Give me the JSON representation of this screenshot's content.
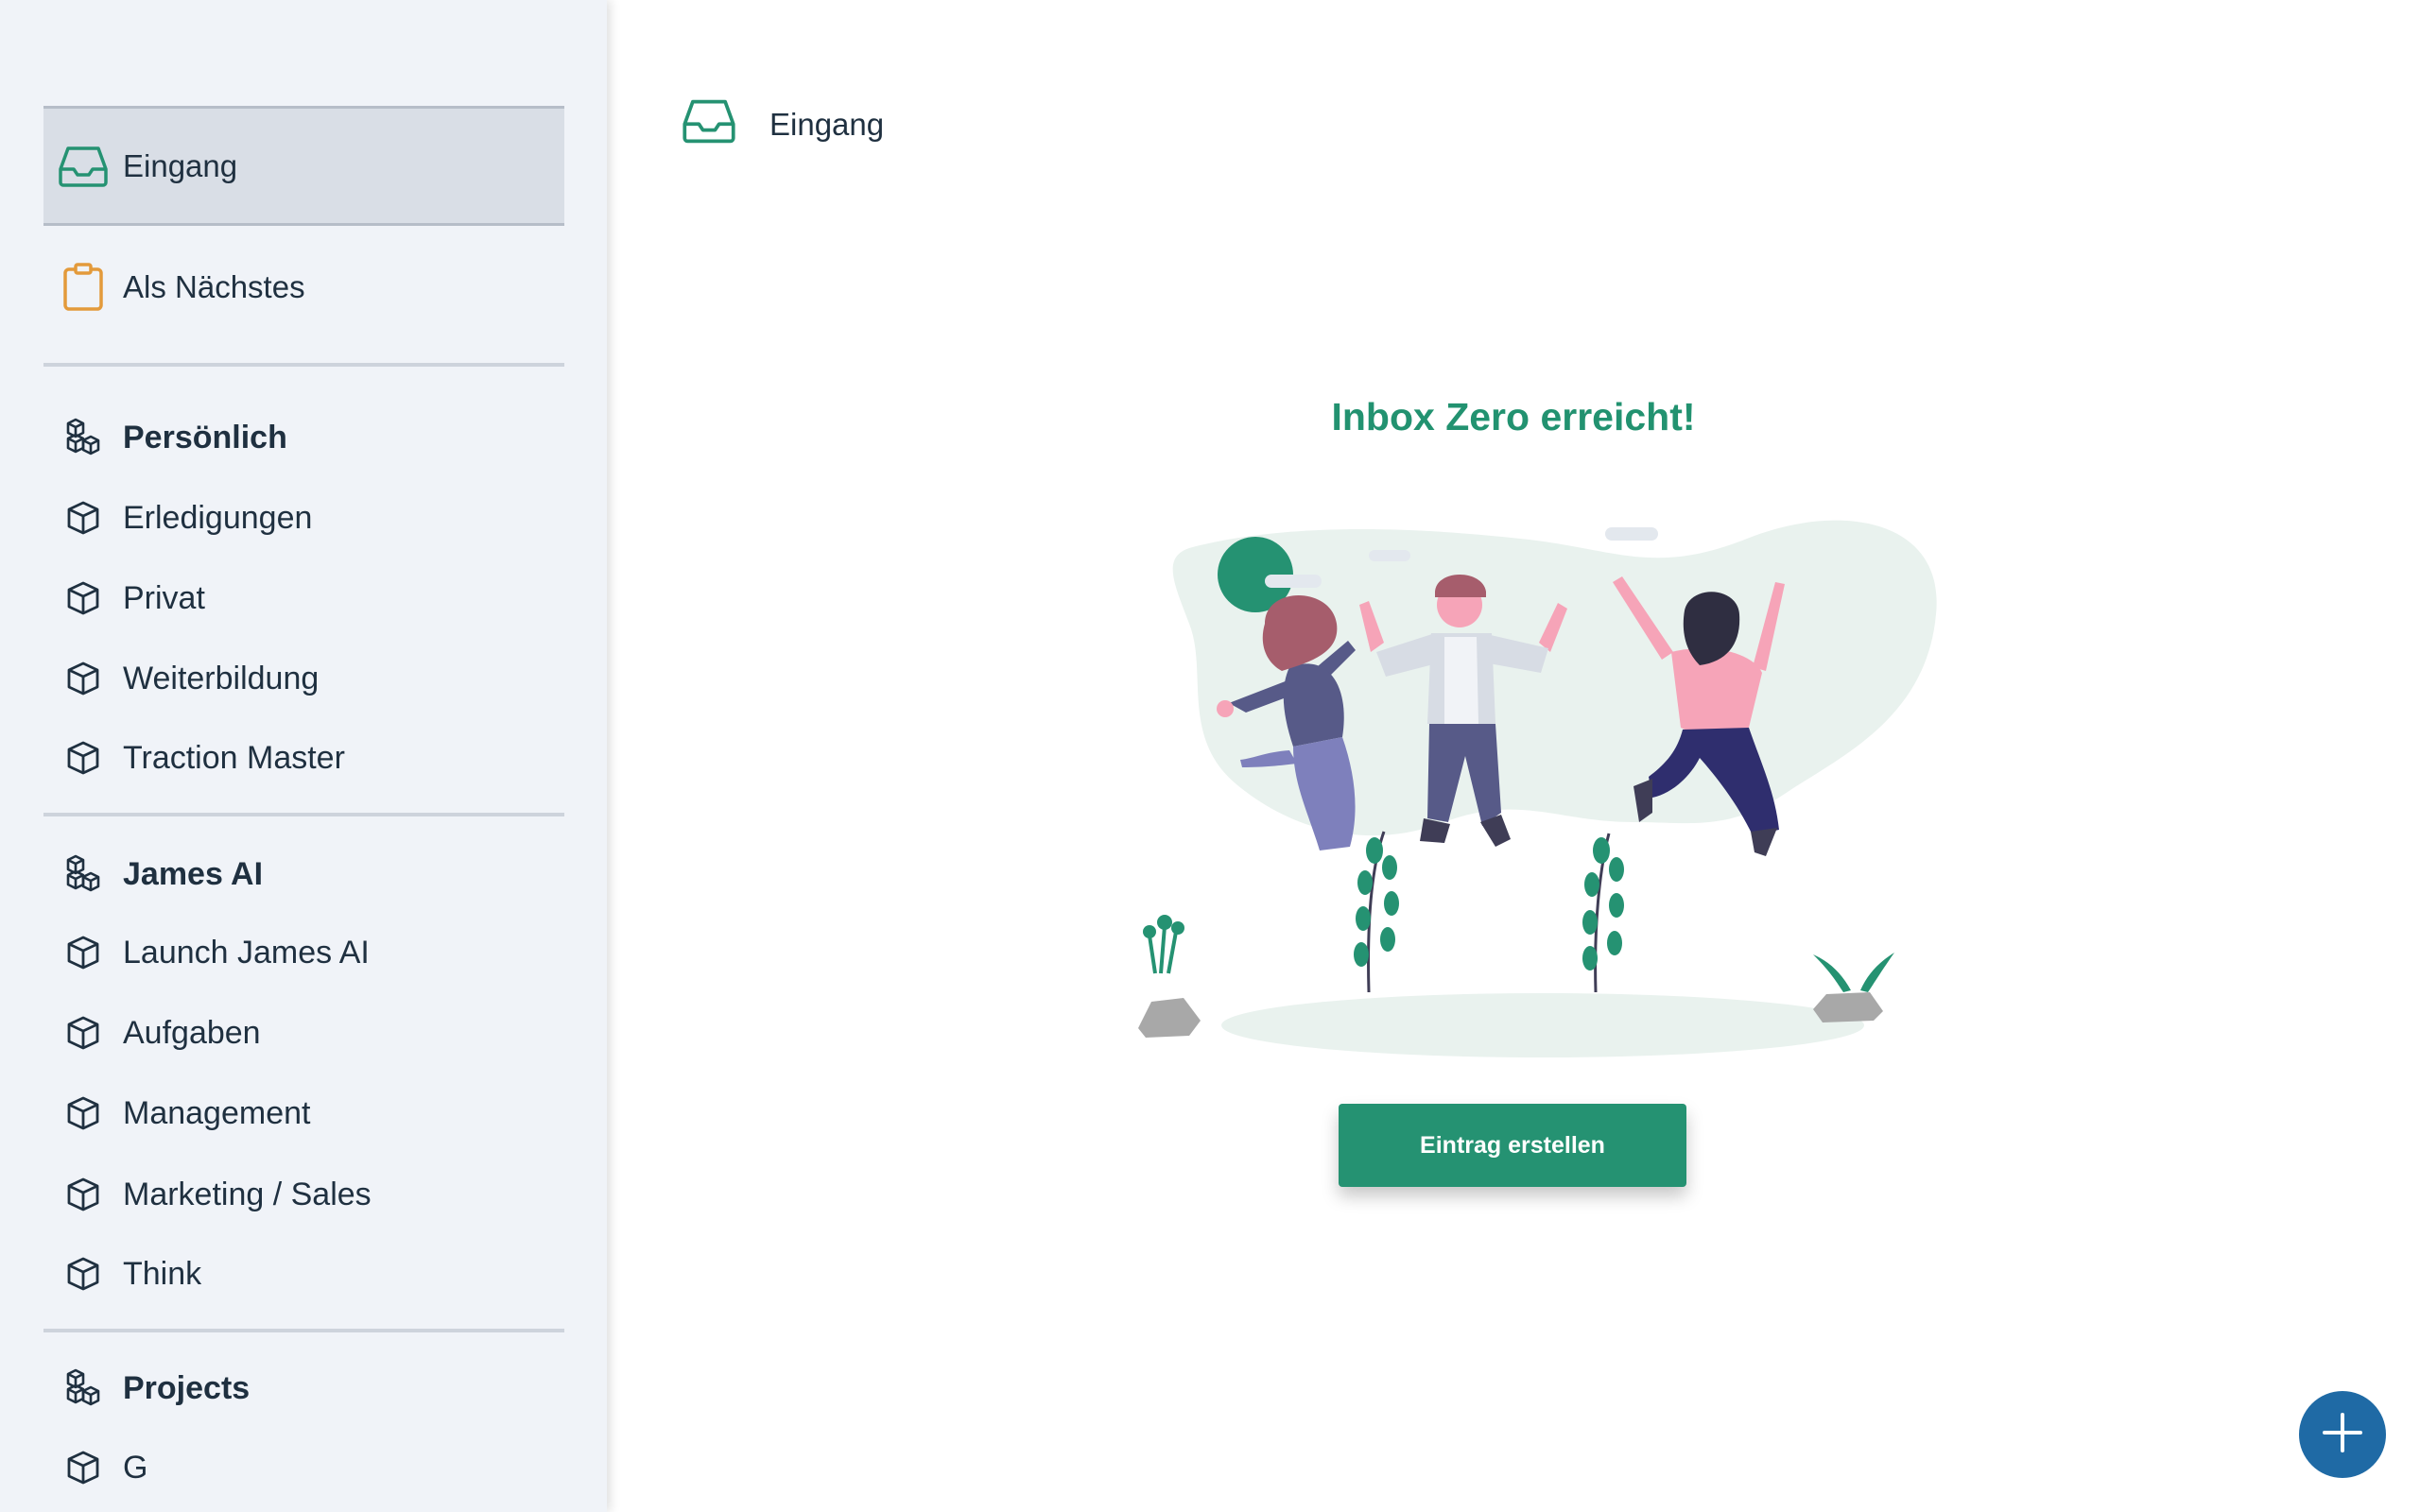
{
  "sidebar": {
    "inbox": {
      "label": "Eingang",
      "icon": "inbox-icon",
      "color": "#259272"
    },
    "next": {
      "label": "Als Nächstes",
      "icon": "clipboard-icon",
      "color": "#e39a3b"
    },
    "groups": [
      {
        "title": "Persönlich",
        "projects": [
          "Erledigungen",
          "Privat",
          "Weiterbildung",
          "Traction Master"
        ]
      },
      {
        "title": "James AI",
        "projects": [
          "Launch James AI",
          "Aufgaben",
          "Management",
          "Marketing / Sales",
          "Think"
        ]
      },
      {
        "title": "Projects",
        "projects": [
          "G"
        ]
      }
    ]
  },
  "header": {
    "title": "Eingang",
    "icon": "inbox-icon"
  },
  "empty_state": {
    "title": "Inbox Zero erreicht!",
    "button_label": "Eintrag erstellen"
  },
  "fab": {
    "icon": "plus-icon"
  },
  "colors": {
    "accent": "#259272",
    "fab": "#1f6aa5",
    "sidebar_bg": "#f0f3f8",
    "selected_bg": "#d9dee6"
  }
}
